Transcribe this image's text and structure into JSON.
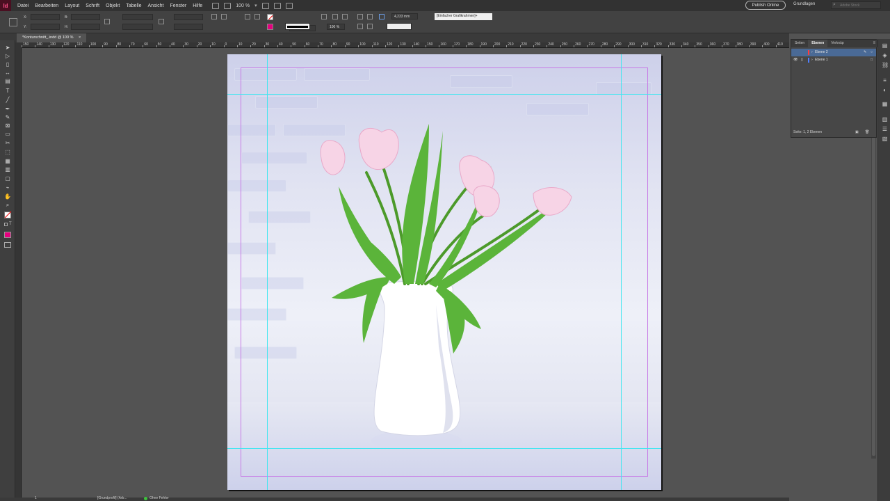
{
  "app": {
    "logo": "Id"
  },
  "menu": [
    "Datei",
    "Bearbeiten",
    "Layout",
    "Schrift",
    "Objekt",
    "Tabelle",
    "Ansicht",
    "Fenster",
    "Hilfe"
  ],
  "zoom": "100 %",
  "header": {
    "publish_label": "Publish Online",
    "workspace_label": "Grundlagen",
    "stock_placeholder": "Adobe Stock"
  },
  "control": {
    "x_label": "X:",
    "y_label": "Y:",
    "b_label": "B:",
    "h_label": "H:",
    "stroke_weight": "1 Pt",
    "opacity": "100 %",
    "size_value": "4,233 mm",
    "object_style": "[Einfacher Grafikrahmen]+"
  },
  "document_tab": {
    "title": "*Konturschnitt_.indd @ 100 %",
    "close": "×"
  },
  "ruler": {
    "labels": [
      "150",
      "140",
      "130",
      "120",
      "110",
      "100",
      "90",
      "80",
      "70",
      "60",
      "50",
      "40",
      "30",
      "20",
      "10",
      "0",
      "10",
      "20",
      "30",
      "40",
      "50",
      "60",
      "70",
      "80",
      "90",
      "100",
      "110",
      "120",
      "130",
      "140",
      "150",
      "160",
      "170",
      "180",
      "190",
      "200",
      "210",
      "220",
      "230",
      "240",
      "250",
      "260",
      "270",
      "280",
      "290",
      "300",
      "310",
      "320",
      "330",
      "340",
      "350",
      "360",
      "370",
      "380",
      "390",
      "400",
      "410"
    ]
  },
  "layers_panel": {
    "tabs": [
      "Seiten",
      "Ebenen",
      "Verknüp"
    ],
    "layers": [
      {
        "name": "Ebene 2",
        "color": "#ff3b3b",
        "selected": true
      },
      {
        "name": "Ebene 1",
        "color": "#4f7fff",
        "selected": false
      }
    ],
    "footer": "Seite: 1, 2 Ebenen"
  },
  "status": {
    "page": "1",
    "style": "[Grundprofil] (Arb...",
    "preflight": "Ohne Fehler"
  },
  "colors": {
    "accent": "#e6007e",
    "guide_cyan": "#40e6f0",
    "margin_purple": "#c77ae6",
    "layer_selected": "#4a6a96"
  }
}
